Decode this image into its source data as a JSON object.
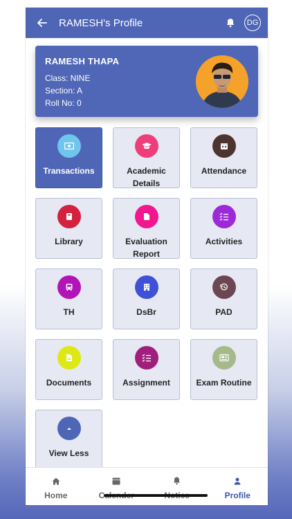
{
  "header": {
    "title": "RAMESH's Profile",
    "avatar_initials": "DG"
  },
  "profile": {
    "name": "RAMESH THAPA",
    "class": "Class: NINE",
    "section": "Section: A",
    "roll": "Roll No: 0"
  },
  "tiles": [
    {
      "label": "Transactions",
      "icon": "money-icon",
      "color": "#6fc5ec",
      "active": true
    },
    {
      "label": "Academic Details",
      "icon": "graduation-cap-icon",
      "color": "#ef3d79"
    },
    {
      "label": "Attendance",
      "icon": "calendar-icon",
      "color": "#4e342e"
    },
    {
      "label": "Library",
      "icon": "book-icon",
      "color": "#d3213f"
    },
    {
      "label": "Evaluation Report",
      "icon": "document-icon",
      "color": "#f2168f"
    },
    {
      "label": "Activities",
      "icon": "checklist-icon",
      "color": "#9c2ad8"
    },
    {
      "label": "TH",
      "icon": "bus-icon",
      "color": "#b214b8"
    },
    {
      "label": "DsBr",
      "icon": "building-icon",
      "color": "#3f51d6"
    },
    {
      "label": "PAD",
      "icon": "history-icon",
      "color": "#6d4653"
    },
    {
      "label": "Documents",
      "icon": "file-icon",
      "color": "#dde814"
    },
    {
      "label": "Assignment",
      "icon": "checklist-icon",
      "color": "#a01f7c"
    },
    {
      "label": "Exam Routine",
      "icon": "newspaper-icon",
      "color": "#a5b98a"
    },
    {
      "label": "View Less",
      "icon": "chevron-up-icon",
      "color": "#4f66b6"
    }
  ],
  "tabbar": {
    "items": [
      {
        "label": "Home",
        "icon": "home-icon"
      },
      {
        "label": "Calender",
        "icon": "calendar-icon"
      },
      {
        "label": "Notice",
        "icon": "bell-icon"
      },
      {
        "label": "Profile",
        "icon": "person-icon",
        "active": true
      }
    ]
  }
}
